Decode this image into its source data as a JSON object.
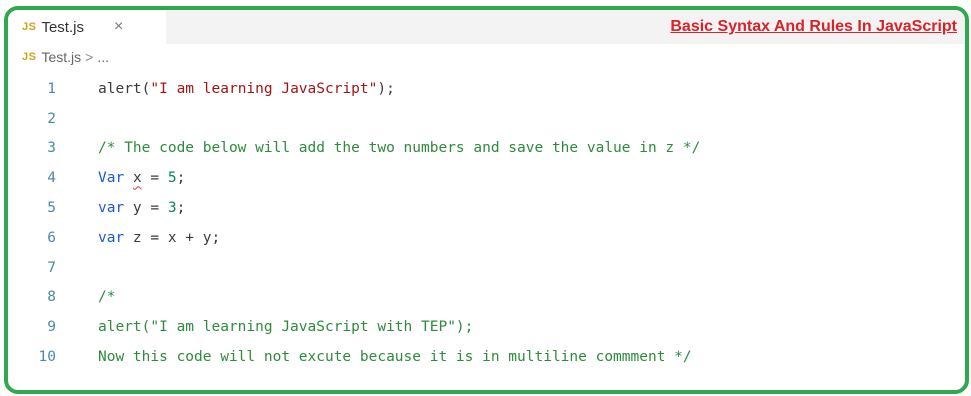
{
  "tab": {
    "badge": "JS",
    "filename": "Test.js",
    "close": "×"
  },
  "heading": "Basic Syntax And Rules In JavaScript",
  "breadcrumb": {
    "badge": "JS",
    "file": "Test.js",
    "separator": ">",
    "rest": "..."
  },
  "code": {
    "line_numbers": [
      "1",
      "2",
      "3",
      "4",
      "5",
      "6",
      "7",
      "8",
      "9",
      "10"
    ],
    "lines": {
      "l1_fn": "alert(",
      "l1_str": "\"I am learning JavaScript\"",
      "l1_end": ");",
      "l3": "/* The code below will add the two numbers and save the value in z */",
      "l4_kw": "Var",
      "l4_var": "x",
      "l4_op": " = ",
      "l4_num": "5",
      "l4_end": ";",
      "l5_kw": "var",
      "l5_rest": " y = ",
      "l5_num": "3",
      "l5_end": ";",
      "l6_kw": "var",
      "l6_rest": " z = x + y;",
      "l8": "/*",
      "l9": "alert(\"I am learning JavaScript with TEP\");",
      "l10": "Now this code will not excute because it is in multiline commment */"
    }
  },
  "colors": {
    "frame_border": "#2fa84f",
    "heading": "#d9232a",
    "keyword": "#1a5bd1",
    "string": "#a31515",
    "number": "#098658",
    "comment": "#2e8b3b"
  }
}
